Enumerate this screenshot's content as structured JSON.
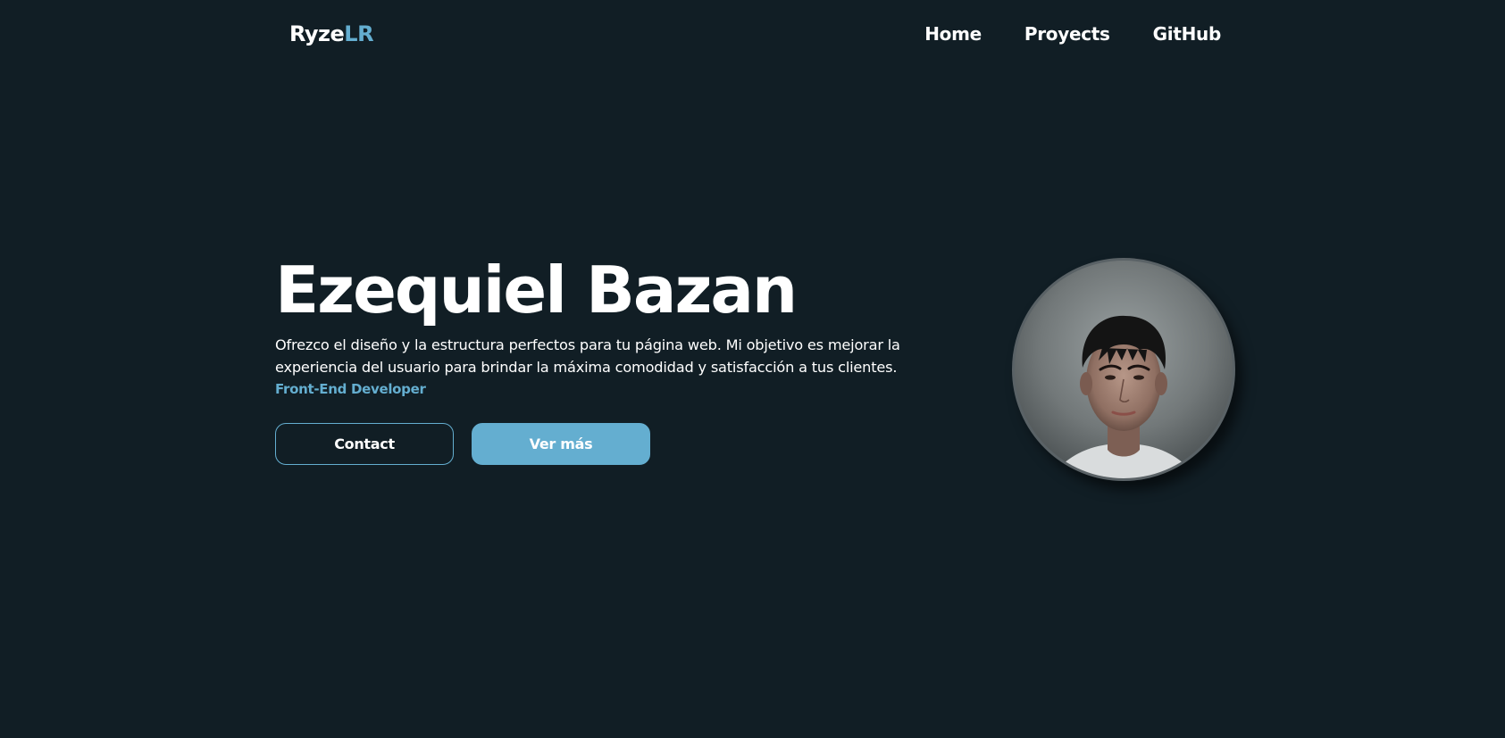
{
  "navbar": {
    "logo": {
      "main": "Ryze",
      "accent": "LR"
    },
    "links": [
      {
        "label": "Home"
      },
      {
        "label": "Proyects"
      },
      {
        "label": "GitHub"
      }
    ]
  },
  "hero": {
    "title": "Ezequiel Bazan",
    "description": "Ofrezco el diseño y la estructura perfectos para tu página web. Mi objetivo es mejorar la experiencia del usuario para brindar la máxima comodidad y satisfacción a tus clientes.",
    "role": "Front-End Developer",
    "buttons": {
      "contact": "Contact",
      "more": "Ver más"
    }
  },
  "avatar": {
    "kind": "profile photo"
  },
  "colors": {
    "background": "#111e25",
    "accent": "#64aed0",
    "text": "#ffffff"
  }
}
